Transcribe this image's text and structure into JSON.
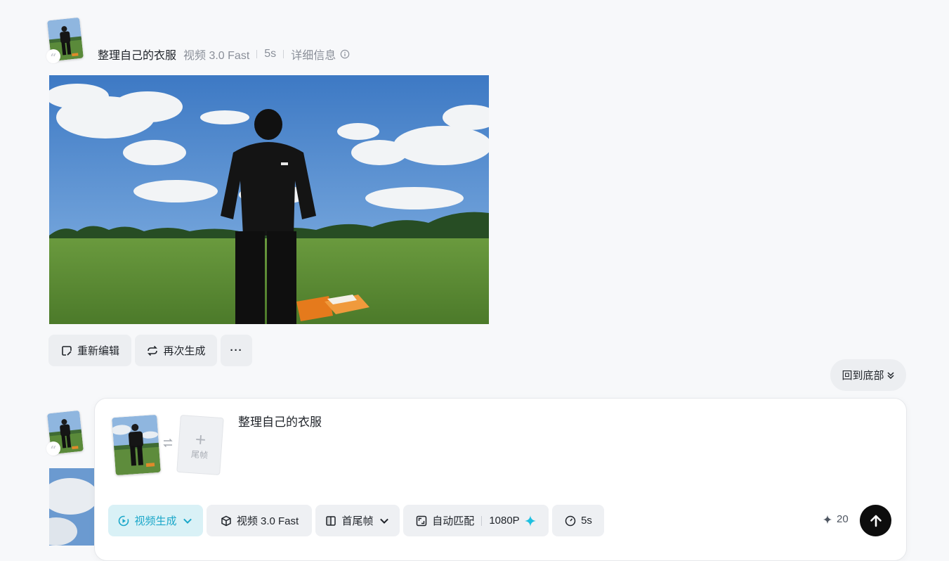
{
  "record": {
    "title": "整理自己的衣服",
    "model": "视频 3.0 Fast",
    "duration": "5s",
    "details_label": "详细信息",
    "quote_badge": "“"
  },
  "actions": {
    "reedit_label": "重新编辑",
    "regenerate_label": "再次生成",
    "more_label": "···"
  },
  "back_to_bottom_label": "回到底部",
  "composer": {
    "end_frame_label": "尾帧",
    "prompt": "整理自己的衣服",
    "mode_label": "视频生成",
    "model_label": "视频 3.0 Fast",
    "frames_label": "首尾帧",
    "ratio_label": "自动匹配",
    "resolution_label": "1080P",
    "duration_label": "5s",
    "credits": "20"
  },
  "colors": {
    "accent": "#1aa7c9",
    "accent_bg": "#d9f1f6",
    "send_button": "#0d0d0d",
    "page_bg": "#f7f8fa"
  },
  "icons": {
    "info": "info-circle-icon",
    "reedit": "edit-icon",
    "regenerate": "refresh-icon",
    "back_bottom": "double-chevron-down-icon",
    "swap": "swap-arrows-icon",
    "mode": "video-play-icon",
    "model": "cube-icon",
    "frames": "frames-icon",
    "ratio": "aspect-ratio-icon",
    "duration": "clock-icon",
    "credits": "sparkle-icon",
    "send": "arrow-up-icon"
  }
}
